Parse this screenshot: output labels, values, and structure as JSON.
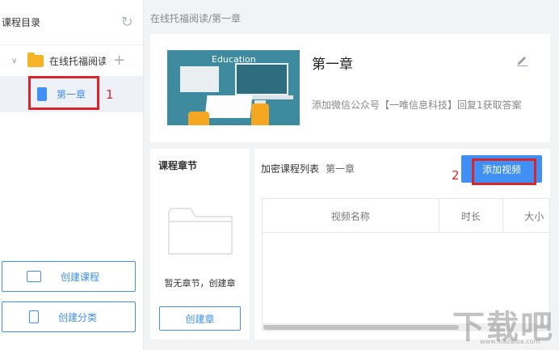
{
  "sidebar": {
    "title": "课程目录",
    "folder_label": "在线托福阅读",
    "selected_item": "第一章",
    "annotation_1": "1",
    "create_course": "创建课程",
    "create_category": "创建分类"
  },
  "breadcrumb": "在线托福阅读/第一章",
  "course_card": {
    "thumb_word": "Education",
    "title": "第一章",
    "description": "添加微信公众号【一唯信息科技】回复1获取答案"
  },
  "sections": {
    "title": "课程章节",
    "empty_text": "暂无章节，创建章",
    "create_button": "创建章"
  },
  "video_list": {
    "title": "加密课程列表",
    "subtitle": "第一章",
    "add_button": "添加视频",
    "annotation_2": "2",
    "columns": [
      "视频名称",
      "时长",
      "大小"
    ]
  },
  "watermark": {
    "main": "下载吧",
    "small": "www.xiazaiba.com"
  },
  "colors": {
    "accent": "#3f8ff5",
    "highlight": "#d9262b",
    "folder": "#f6b325"
  }
}
